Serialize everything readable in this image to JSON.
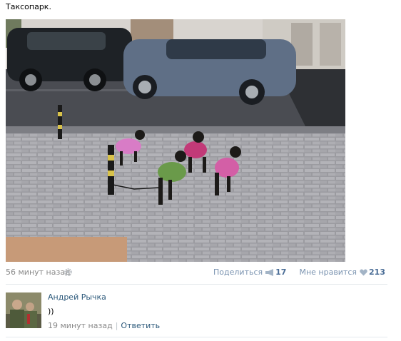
{
  "post": {
    "text": "Таксопарк.",
    "photo_alt": "dachshunds in sweaters",
    "time": "56 минут назад",
    "share_label": "Поделиться",
    "share_count": "17",
    "like_label": "Мне нравится",
    "like_count": "213"
  },
  "comment": {
    "author": "Андрей Рычка",
    "text": "))",
    "time": "19 минут назад",
    "reply_label": "Ответить"
  },
  "colors": {
    "link": "#2b587a",
    "muted": "#8a8a8a",
    "action": "#7a93b0",
    "count": "#4a6d96"
  }
}
